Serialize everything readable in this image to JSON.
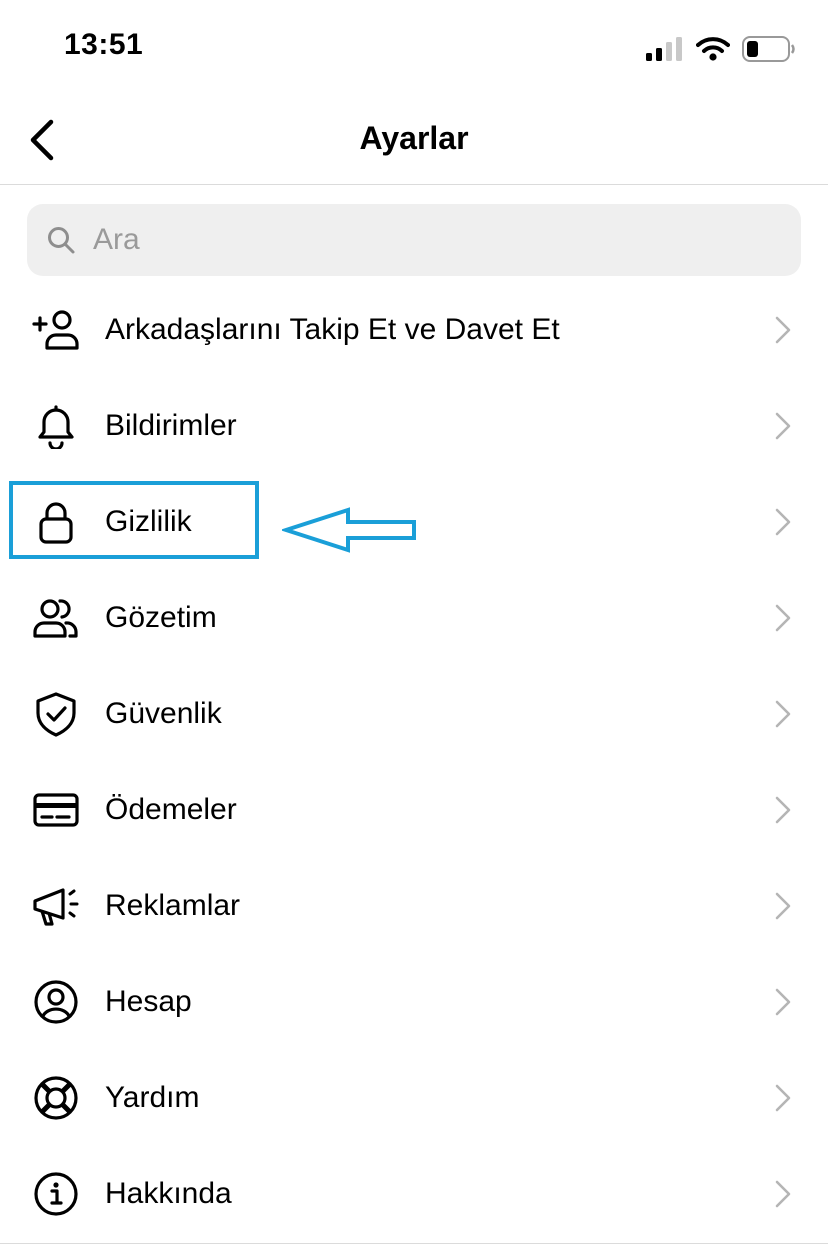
{
  "status_bar": {
    "time": "13:51"
  },
  "header": {
    "title": "Ayarlar"
  },
  "search": {
    "placeholder": "Ara",
    "value": ""
  },
  "settings": {
    "items": [
      {
        "label": "Arkadaşlarını Takip Et ve Davet Et",
        "icon": "add-person-icon"
      },
      {
        "label": "Bildirimler",
        "icon": "bell-icon"
      },
      {
        "label": "Gizlilik",
        "icon": "lock-icon"
      },
      {
        "label": "Gözetim",
        "icon": "people-icon"
      },
      {
        "label": "Güvenlik",
        "icon": "shield-check-icon"
      },
      {
        "label": "Ödemeler",
        "icon": "credit-card-icon"
      },
      {
        "label": "Reklamlar",
        "icon": "megaphone-icon"
      },
      {
        "label": "Hesap",
        "icon": "user-circle-icon"
      },
      {
        "label": "Yardım",
        "icon": "lifebuoy-icon"
      },
      {
        "label": "Hakkında",
        "icon": "info-icon"
      }
    ]
  },
  "annotation": {
    "color": "#1a9fd8"
  }
}
